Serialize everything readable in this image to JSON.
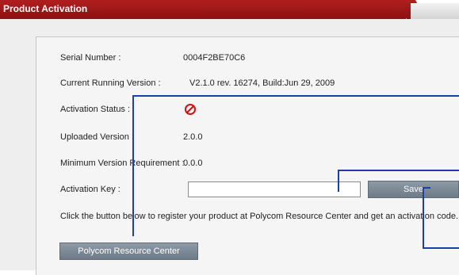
{
  "window": {
    "title": "Product Activation"
  },
  "fields": {
    "serial_label": "Serial Number :",
    "serial_value": "0004F2BE70C6",
    "current_version_label": "Current Running Version :",
    "current_version_value": "V2.1.0 rev. 16274, Build:Jun 29, 2009",
    "activation_status_label": "Activation Status :",
    "activation_status_icon": "no-entry-icon",
    "uploaded_version_label": "Uploaded Version :",
    "uploaded_version_value": "2.0.0",
    "min_version_label": "Minimum Version Requirement :",
    "min_version_value": "0.0.0",
    "activation_key_label": "Activation Key :",
    "activation_key_value": ""
  },
  "buttons": {
    "save": "Save",
    "resource_center": "Polycom Resource Center"
  },
  "note": "Click the button below to register your product at Polycom Resource Center and get an activation code.",
  "colors": {
    "title_bar": "#a01818",
    "button": "#7d8996",
    "status_icon": "#d01010",
    "annotation_lines": "#1f3fa8"
  }
}
